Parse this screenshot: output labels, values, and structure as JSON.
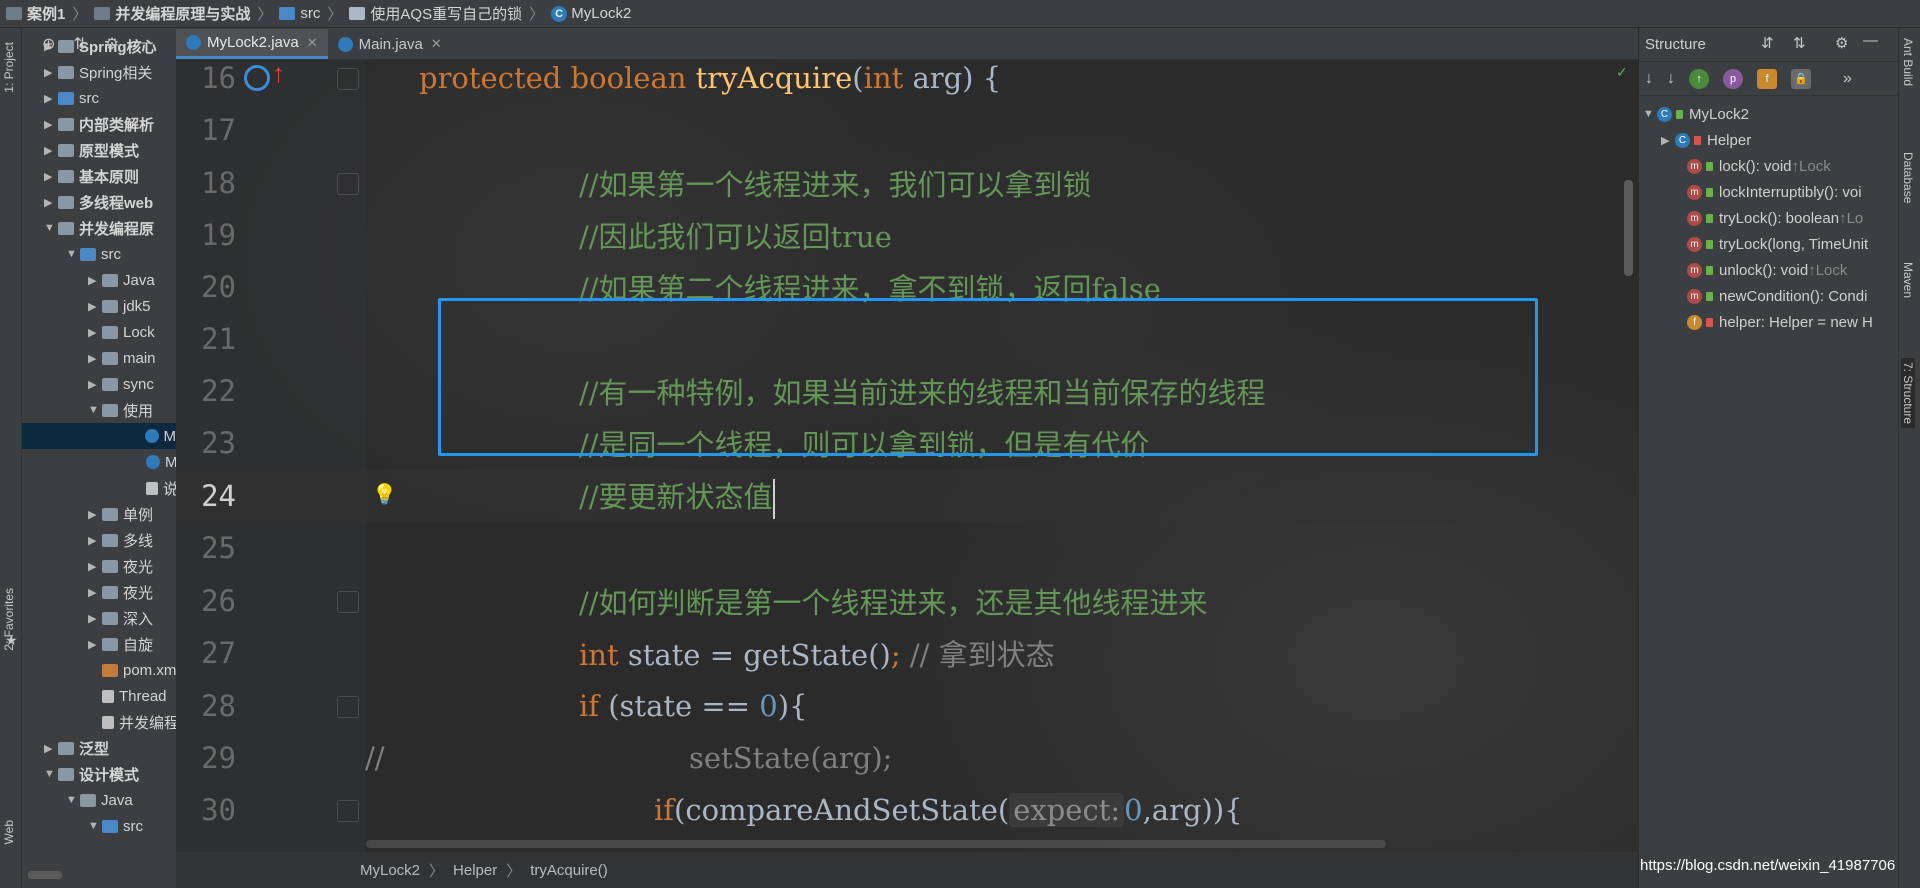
{
  "navbar": {
    "crumbs": [
      "案例1",
      "并发编程原理与实战",
      "src",
      "使用AQS重写自己的锁",
      "MyLock2"
    ]
  },
  "left_strip": {
    "project_tab": "1: Project",
    "favorites_tab": "2: Favorites",
    "web_tab": "Web"
  },
  "project_tree": [
    {
      "label": "Spring核心",
      "bold": true
    },
    {
      "label": "Spring相关",
      "bold": false
    },
    {
      "label": "src",
      "bold": false
    },
    {
      "label": "内部类解析",
      "bold": true
    },
    {
      "label": "原型模式",
      "bold": true
    },
    {
      "label": "基本原则",
      "bold": true
    },
    {
      "label": "多线程web",
      "bold": true
    },
    {
      "label": "并发编程原",
      "bold": true
    },
    {
      "label": "src",
      "bold": false
    },
    {
      "label": "Java",
      "bold": false
    },
    {
      "label": "jdk5",
      "bold": false
    },
    {
      "label": "Lock",
      "bold": false
    },
    {
      "label": "main",
      "bold": false
    },
    {
      "label": "sync",
      "bold": false
    },
    {
      "label": "使用",
      "bold": false
    },
    {
      "label": "M",
      "bold": false
    },
    {
      "label": "M",
      "bold": false
    },
    {
      "label": "说",
      "bold": false
    },
    {
      "label": "单例",
      "bold": false
    },
    {
      "label": "多线",
      "bold": false
    },
    {
      "label": "夜光",
      "bold": false
    },
    {
      "label": "夜光",
      "bold": false
    },
    {
      "label": "深入",
      "bold": false
    },
    {
      "label": "自旋",
      "bold": false
    },
    {
      "label": "pom.xm",
      "bold": false
    },
    {
      "label": "Thread",
      "bold": false
    },
    {
      "label": "并发编程",
      "bold": false
    },
    {
      "label": "泛型",
      "bold": true
    },
    {
      "label": "设计模式",
      "bold": true
    },
    {
      "label": "Java",
      "bold": false
    },
    {
      "label": "src",
      "bold": false
    }
  ],
  "tabs": [
    {
      "label": "MyLock2.java",
      "active": true
    },
    {
      "label": "Main.java",
      "active": false
    }
  ],
  "editor": {
    "lines": [
      {
        "num": "16"
      },
      {
        "num": "17"
      },
      {
        "num": "18"
      },
      {
        "num": "19"
      },
      {
        "num": "20"
      },
      {
        "num": "21"
      },
      {
        "num": "22"
      },
      {
        "num": "23"
      },
      {
        "num": "24"
      },
      {
        "num": "25"
      },
      {
        "num": "26"
      },
      {
        "num": "27"
      },
      {
        "num": "28"
      },
      {
        "num": "29"
      },
      {
        "num": "30"
      }
    ],
    "code": {
      "l16_kw1": "protected",
      "l16_kw2": "boolean",
      "l16_fn": "tryAcquire",
      "l16_kw3": "int",
      "l16_rest": " arg) {",
      "l18": "//如果第一个线程进来，我们可以拿到锁",
      "l19": "//因此我们可以返回true",
      "l20": "//如果第二个线程进来，拿不到锁，返回false",
      "l22": "//有一种特例，如果当前进来的线程和当前保存的线程",
      "l23": "//是同一个线程，则可以拿到锁，但是有代价",
      "l24": "//要更新状态值",
      "l26": "//如何判断是第一个线程进来，还是其他线程进来",
      "l27_kw": "int",
      "l27_rest": " state = getState()",
      "l27_semi": ";",
      "l27_cm": " // 拿到状态",
      "l28_kw": "if",
      "l28_rest": " (state == ",
      "l28_num": "0",
      "l28_end": "){",
      "l29_cm": "//",
      "l29_code": "setState(arg);",
      "l30_kw": "if",
      "l30_rest": "(compareAndSetState(",
      "l30_hint": "expect:",
      "l30_num": "0",
      "l30_end": ",arg)){"
    }
  },
  "editor_breadcrumb": [
    "MyLock2",
    "Helper",
    "tryAcquire()"
  ],
  "structure": {
    "title": "Structure",
    "root": "MyLock2",
    "items": [
      {
        "label": "Helper",
        "suffix": "",
        "type": "class"
      },
      {
        "label": "lock(): void ",
        "suffix": "↑Lock",
        "type": "method"
      },
      {
        "label": "lockInterruptibly(): voi",
        "suffix": "",
        "type": "method"
      },
      {
        "label": "tryLock(): boolean ",
        "suffix": "↑Lo",
        "type": "method"
      },
      {
        "label": "tryLock(long, TimeUnit",
        "suffix": "",
        "type": "method"
      },
      {
        "label": "unlock(): void ",
        "suffix": "↑Lock",
        "type": "method"
      },
      {
        "label": "newCondition(): Condi",
        "suffix": "",
        "type": "method"
      },
      {
        "label": "helper: Helper = new H",
        "suffix": "",
        "type": "field"
      }
    ]
  },
  "right_strip": {
    "ant": "Ant Build",
    "database": "Database",
    "maven": "Maven",
    "structure": "7: Structure"
  },
  "watermark": "https://blog.csdn.net/weixin_41987706",
  "colors": {
    "accent": "#2196f3",
    "keyword": "#cc7832",
    "comment": "#629755",
    "function": "#ffc66d",
    "number": "#6897bb"
  }
}
